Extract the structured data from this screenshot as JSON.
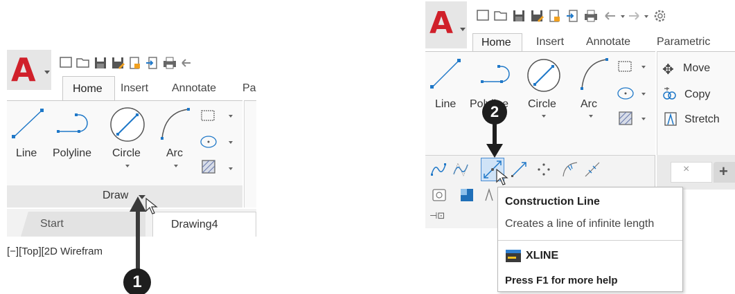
{
  "left": {
    "app_letter": "A",
    "tabs": [
      "Home",
      "Insert",
      "Annotate",
      "Pa"
    ],
    "tools": [
      "Line",
      "Polyline",
      "Circle",
      "Arc"
    ],
    "panel_title": "Draw",
    "doc_tabs": [
      "Start",
      "Drawing4"
    ],
    "viewport_label": "[−][Top][2D Wirefram",
    "callout": "1"
  },
  "right": {
    "app_letter": "A",
    "tabs": [
      "Home",
      "Insert",
      "Annotate",
      "Parametric"
    ],
    "tools": [
      "Line",
      "Polyline",
      "Circle",
      "Arc"
    ],
    "modify_tools": [
      "Move",
      "Copy",
      "Stretch"
    ],
    "callout": "2",
    "tooltip": {
      "title": "Construction Line",
      "description": "Creates a line of infinite length",
      "command": "XLINE",
      "help": "Press F1 for more help"
    }
  },
  "colors": {
    "brand_red": "#d0202a",
    "tool_blue": "#1f78c8",
    "callout_bg": "#1e1e1e",
    "highlight": "#cfe3f7"
  }
}
